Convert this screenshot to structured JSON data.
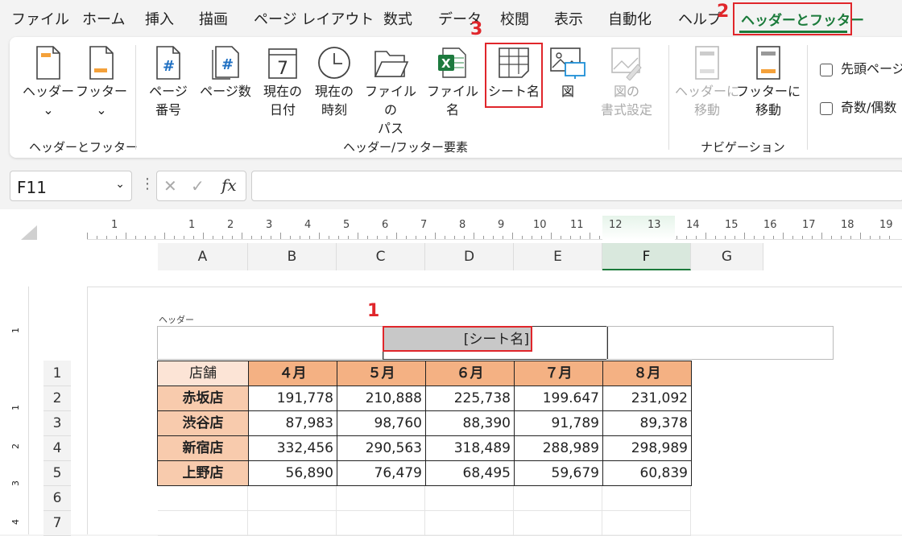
{
  "menu": {
    "items": [
      "ファイル",
      "ホーム",
      "挿入",
      "描画",
      "ページ レイアウト",
      "数式",
      "データ",
      "校閲",
      "表示",
      "自動化",
      "ヘルプ",
      "ヘッダーとフッター"
    ]
  },
  "annotations": {
    "n1": "1",
    "n2": "2",
    "n3": "3"
  },
  "ribbon": {
    "header": {
      "l1": "ヘッダー",
      "l2": "⌄"
    },
    "footer": {
      "l1": "フッター",
      "l2": "⌄"
    },
    "page_number": {
      "l1": "ページ",
      "l2": "番号"
    },
    "page_count": {
      "l1": "ページ数"
    },
    "current_date": {
      "l1": "現在の",
      "l2": "日付"
    },
    "current_time": {
      "l1": "現在の",
      "l2": "時刻"
    },
    "file_path": {
      "l1": "ファイルの",
      "l2": "パス"
    },
    "file_name": {
      "l1": "ファイル名"
    },
    "sheet_name": {
      "l1": "シート名"
    },
    "picture": {
      "l1": "図"
    },
    "format_picture": {
      "l1": "図の",
      "l2": "書式設定"
    },
    "goto_header": {
      "l1": "ヘッダーに",
      "l2": "移動"
    },
    "goto_footer": {
      "l1": "フッターに",
      "l2": "移動"
    },
    "opt1": "先頭ページ",
    "opt2": "奇数/偶数",
    "groups": {
      "g1": "ヘッダーとフッター",
      "g2": "ヘッダー/フッター要素",
      "g3": "ナビゲーション"
    }
  },
  "formula_bar": {
    "name_box": "F11",
    "cancel": "✕",
    "enter": "✓",
    "fx": "fx",
    "formula": ""
  },
  "ruler": {
    "marks": [
      "1",
      "1",
      "2",
      "3",
      "4",
      "5",
      "6",
      "7",
      "8",
      "9",
      "10",
      "11",
      "12",
      "13",
      "14",
      "15",
      "16",
      "17",
      "18",
      "19"
    ]
  },
  "columns": [
    "A",
    "B",
    "C",
    "D",
    "E",
    "F",
    "G"
  ],
  "rows": [
    "1",
    "2",
    "3",
    "4",
    "5",
    "6",
    "7"
  ],
  "vruler": [
    "1",
    "1",
    "2",
    "3",
    "4"
  ],
  "header_label": "ヘッダー",
  "header_field": "[シート名]",
  "table": {
    "corner": "店舗",
    "months": [
      "４月",
      "５月",
      "６月",
      "７月",
      "８月"
    ],
    "rows": [
      {
        "shop": "赤坂店",
        "values": [
          "191,778",
          "210,888",
          "225,738",
          "199.647",
          "231,092"
        ]
      },
      {
        "shop": "渋谷店",
        "values": [
          "87,983",
          "98,760",
          "88,390",
          "91,789",
          "89,378"
        ]
      },
      {
        "shop": "新宿店",
        "values": [
          "332,456",
          "290,563",
          "318,489",
          "288,989",
          "298,989"
        ]
      },
      {
        "shop": "上野店",
        "values": [
          "56,890",
          "76,479",
          "68,495",
          "59,679",
          "60,839"
        ]
      }
    ]
  },
  "colors": {
    "accent": "#1a7a3a",
    "highlight": "#e0262b",
    "header_fill": "#f4b183",
    "shop_fill": "#f8cbad"
  }
}
